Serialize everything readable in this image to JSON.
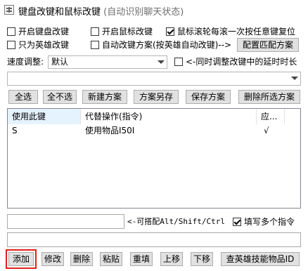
{
  "window": {
    "title": "键盘改键和鼠标改键",
    "subtitle": "(自动识别聊天状态)"
  },
  "options": {
    "enable_keyboard": {
      "label": "开启键盘改键",
      "checked": false
    },
    "enable_mouse": {
      "label": "开启鼠标改键",
      "checked": false
    },
    "wheel_reset": {
      "label": "鼠标滚轮每滚一次按任意键复位",
      "checked": true
    },
    "hero_only": {
      "label": "只为英雄改键",
      "checked": false
    },
    "auto_scheme": {
      "label": "自动改键方案(按英雄自动改键)-->",
      "checked": false
    },
    "config_button": "配置匹配方案"
  },
  "speed": {
    "label": "速度调整:",
    "value": "默认",
    "sync_delay": {
      "label": "<-同时调整改键中的延时时长",
      "checked": false
    }
  },
  "scheme_select": {
    "value": ""
  },
  "toolbar": [
    "全选",
    "全不选",
    "新建方案",
    "方案另存",
    "保存方案",
    "删除所选方案"
  ],
  "table": {
    "headers": [
      "使用此键",
      "代替操作(指令)",
      "应..."
    ],
    "rows": [
      {
        "key": "S",
        "action": "使用物品I50I",
        "applied": "√"
      }
    ]
  },
  "command": {
    "value": "",
    "hint": "<-可搭配Alt/Shift/Ctrl",
    "multi": {
      "label": "填写多个指令",
      "checked": true
    }
  },
  "bottom_input": {
    "value": ""
  },
  "bottom_buttons": [
    "添加",
    "修改",
    "删除",
    "粘贴",
    "重填",
    "上移",
    "下移",
    "查英雄技能物品ID"
  ]
}
